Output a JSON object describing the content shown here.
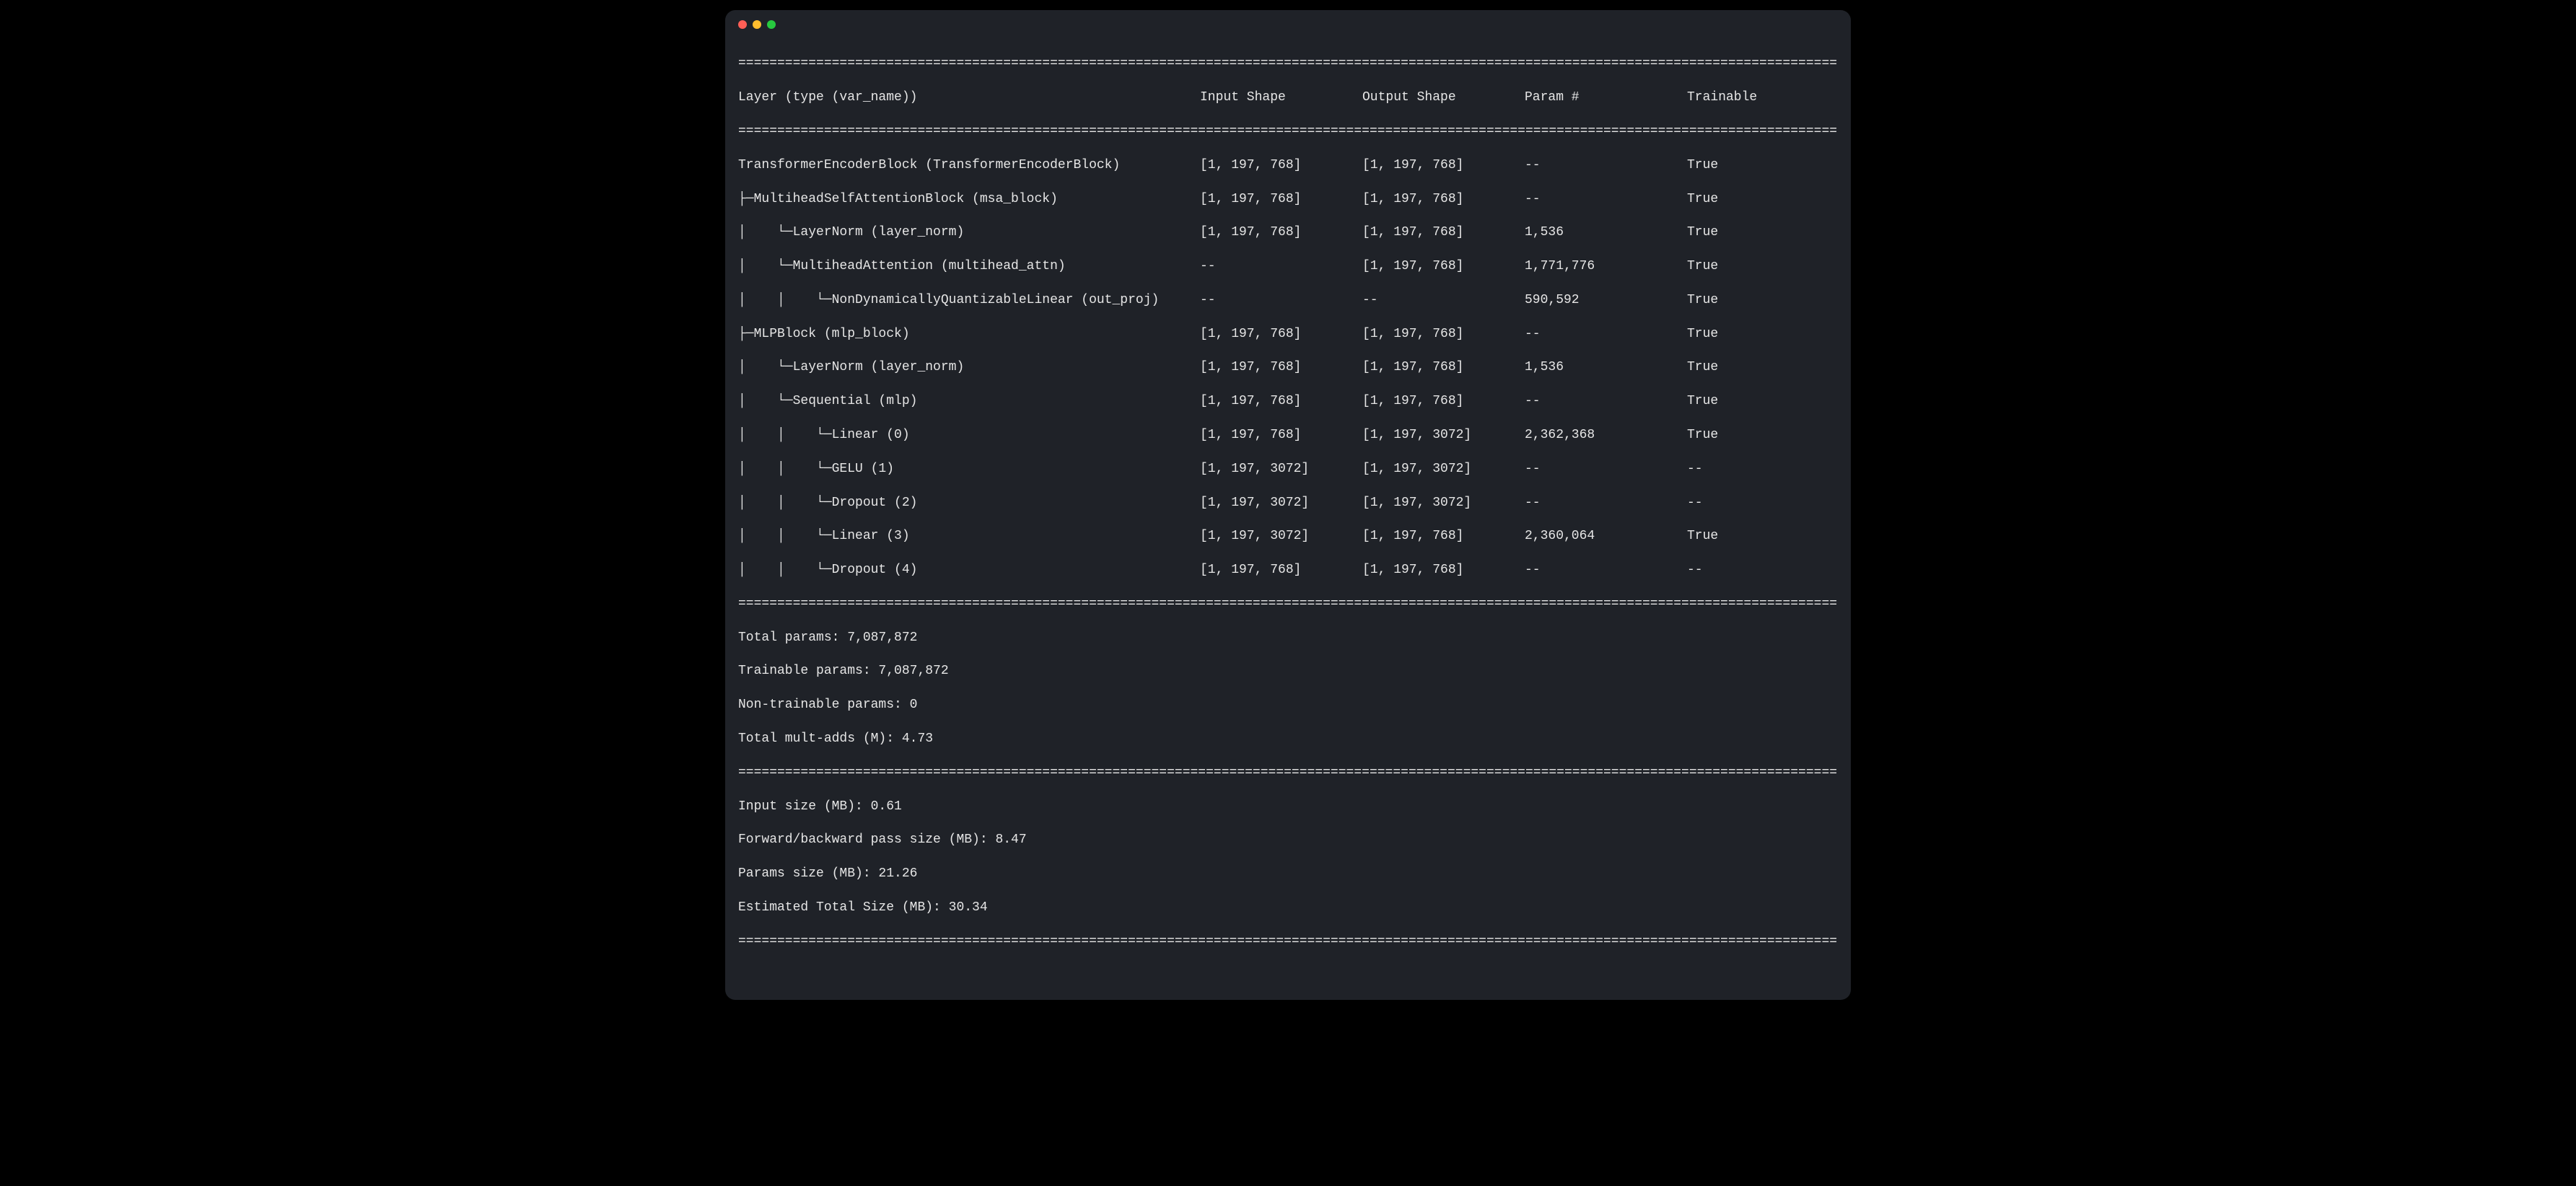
{
  "headers": {
    "layer": "Layer (type (var_name))",
    "input": "Input Shape",
    "output": "Output Shape",
    "params": "Param #",
    "trainable": "Trainable"
  },
  "rows": [
    {
      "layer": "TransformerEncoderBlock (TransformerEncoderBlock)",
      "input": "[1, 197, 768]",
      "output": "[1, 197, 768]",
      "params": "--",
      "trainable": "True"
    },
    {
      "layer": "├─MultiheadSelfAttentionBlock (msa_block)",
      "input": "[1, 197, 768]",
      "output": "[1, 197, 768]",
      "params": "--",
      "trainable": "True"
    },
    {
      "layer": "│    └─LayerNorm (layer_norm)",
      "input": "[1, 197, 768]",
      "output": "[1, 197, 768]",
      "params": "1,536",
      "trainable": "True"
    },
    {
      "layer": "│    └─MultiheadAttention (multihead_attn)",
      "input": "--",
      "output": "[1, 197, 768]",
      "params": "1,771,776",
      "trainable": "True"
    },
    {
      "layer": "│    │    └─NonDynamicallyQuantizableLinear (out_proj)",
      "input": "--",
      "output": "--",
      "params": "590,592",
      "trainable": "True"
    },
    {
      "layer": "├─MLPBlock (mlp_block)",
      "input": "[1, 197, 768]",
      "output": "[1, 197, 768]",
      "params": "--",
      "trainable": "True"
    },
    {
      "layer": "│    └─LayerNorm (layer_norm)",
      "input": "[1, 197, 768]",
      "output": "[1, 197, 768]",
      "params": "1,536",
      "trainable": "True"
    },
    {
      "layer": "│    └─Sequential (mlp)",
      "input": "[1, 197, 768]",
      "output": "[1, 197, 768]",
      "params": "--",
      "trainable": "True"
    },
    {
      "layer": "│    │    └─Linear (0)",
      "input": "[1, 197, 768]",
      "output": "[1, 197, 3072]",
      "params": "2,362,368",
      "trainable": "True"
    },
    {
      "layer": "│    │    └─GELU (1)",
      "input": "[1, 197, 3072]",
      "output": "[1, 197, 3072]",
      "params": "--",
      "trainable": "--"
    },
    {
      "layer": "│    │    └─Dropout (2)",
      "input": "[1, 197, 3072]",
      "output": "[1, 197, 3072]",
      "params": "--",
      "trainable": "--"
    },
    {
      "layer": "│    │    └─Linear (3)",
      "input": "[1, 197, 3072]",
      "output": "[1, 197, 768]",
      "params": "2,360,064",
      "trainable": "True"
    },
    {
      "layer": "│    │    └─Dropout (4)",
      "input": "[1, 197, 768]",
      "output": "[1, 197, 768]",
      "params": "--",
      "trainable": "--"
    }
  ],
  "totals": [
    "Total params: 7,087,872",
    "Trainable params: 7,087,872",
    "Non-trainable params: 0",
    "Total mult-adds (M): 4.73"
  ],
  "sizes": [
    "Input size (MB): 0.61",
    "Forward/backward pass size (MB): 8.47",
    "Params size (MB): 21.26",
    "Estimated Total Size (MB): 30.34"
  ],
  "rule": "=========================================================================================================================================================="
}
